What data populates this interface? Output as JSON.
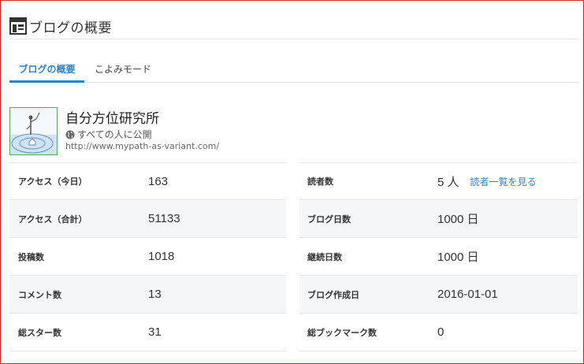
{
  "header": {
    "title": "ブログの概要",
    "icon": "dashboard-icon"
  },
  "tabs": [
    {
      "label": "ブログの概要",
      "active": true
    },
    {
      "label": "こよみモード",
      "active": false
    }
  ],
  "blog": {
    "title": "自分方位研究所",
    "visibility": "すべての人に公開",
    "url": "http://www.mypath-as-variant.com/"
  },
  "stats_left": [
    {
      "label": "アクセス（今日）",
      "value": "163"
    },
    {
      "label": "アクセス（合計）",
      "value": "51133"
    },
    {
      "label": "投稿数",
      "value": "1018"
    },
    {
      "label": "コメント数",
      "value": "13"
    },
    {
      "label": "総スター数",
      "value": "31"
    }
  ],
  "stats_right": [
    {
      "label": "読者数",
      "value": "5 人",
      "link": "読者一覧を見る"
    },
    {
      "label": "ブログ日数",
      "value": "1000 日"
    },
    {
      "label": "継続日数",
      "value": "1000 日"
    },
    {
      "label": "ブログ作成日",
      "value": "2016-01-01"
    },
    {
      "label": "総ブックマーク数",
      "value": "0"
    }
  ],
  "colors": {
    "accent": "#2b84c4",
    "frame": "#c8282d",
    "row_shade": "#f5f6f7"
  }
}
